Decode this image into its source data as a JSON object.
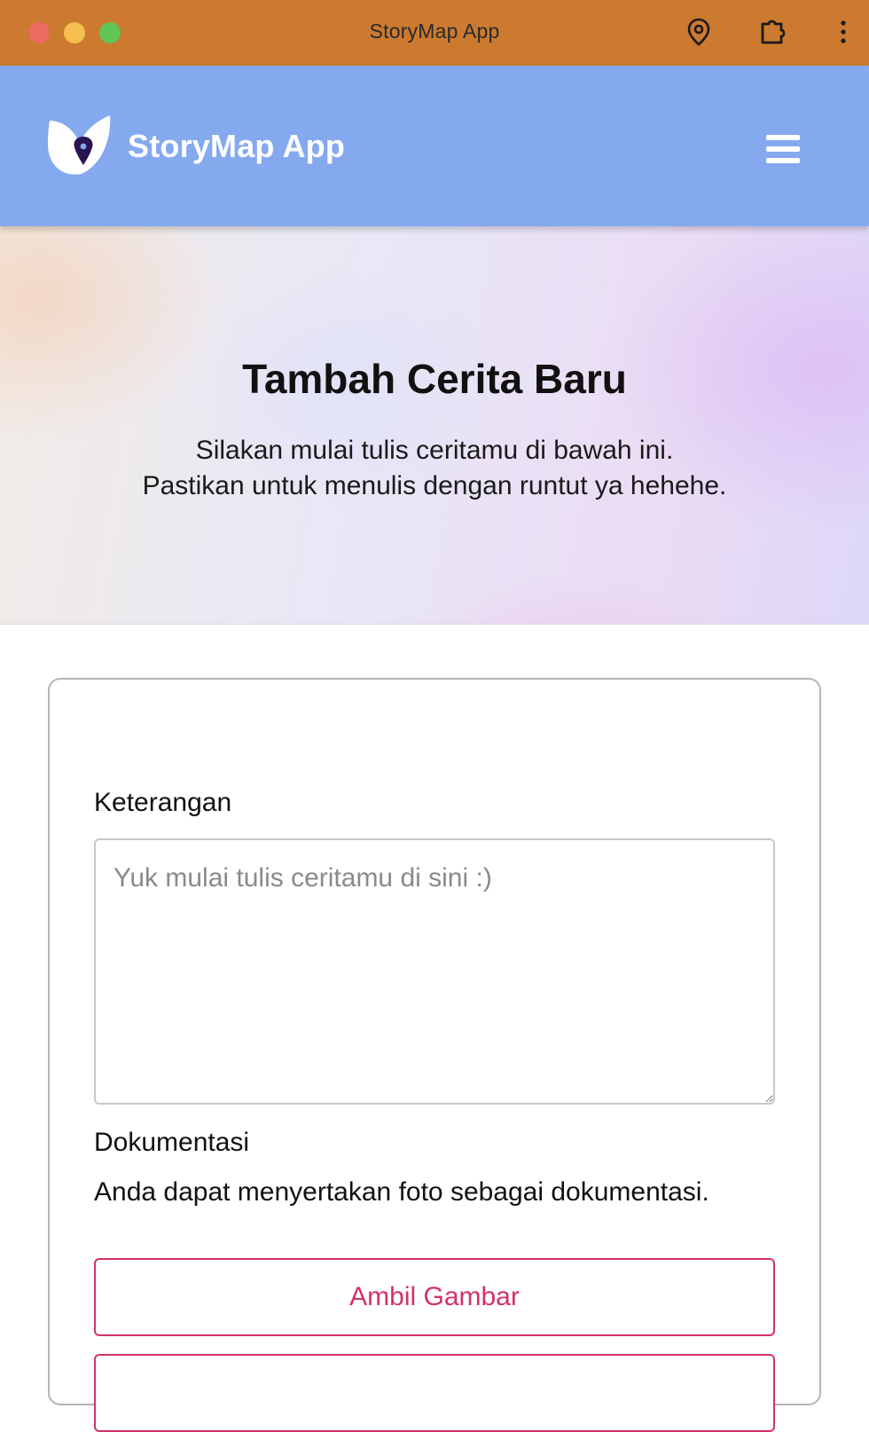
{
  "window": {
    "title": "StoryMap App",
    "icons": [
      "location-pin-icon",
      "extension-puzzle-icon",
      "more-vertical-icon"
    ],
    "titlebar_color": "#cc7a2f"
  },
  "header": {
    "brand": "StoryMap App",
    "logo_icon": "storymap-logo-icon",
    "menu_icon": "hamburger-menu-icon",
    "background_color": "#85a9ef"
  },
  "hero": {
    "title": "Tambah Cerita Baru",
    "subtitle_line1": "Silakan mulai tulis ceritamu di bawah ini.",
    "subtitle_line2": "Pastikan untuk menulis dengan runtut ya hehehe."
  },
  "form": {
    "description_label": "Keterangan",
    "description_placeholder": "Yuk mulai tulis ceritamu di sini :)",
    "description_value": "",
    "documentation_label": "Dokumentasi",
    "documentation_hint": "Anda dapat menyertakan foto sebagai dokumentasi.",
    "camera_button_label": "Ambil Gambar",
    "accent_color": "#d3316b"
  }
}
